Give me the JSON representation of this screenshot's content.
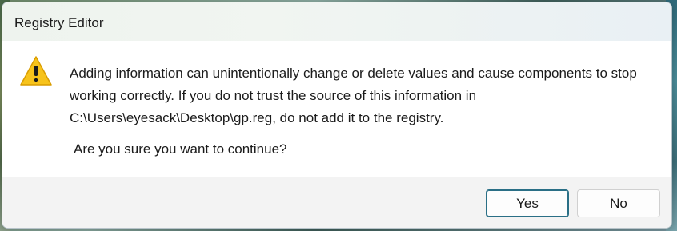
{
  "dialog": {
    "title": "Registry Editor",
    "icon": "warning-icon",
    "message": "Adding information can unintentionally change or delete values and cause components to stop working correctly. If you do not trust the source of this information in C:\\Users\\eyesack\\Desktop\\gp.reg, do not add it to the registry.",
    "question": "Are you sure you want to continue?",
    "buttons": {
      "yes_label": "Yes",
      "no_label": "No"
    }
  },
  "colors": {
    "warning_fill": "#f7c31b",
    "primary_border": "#2a6f86"
  }
}
